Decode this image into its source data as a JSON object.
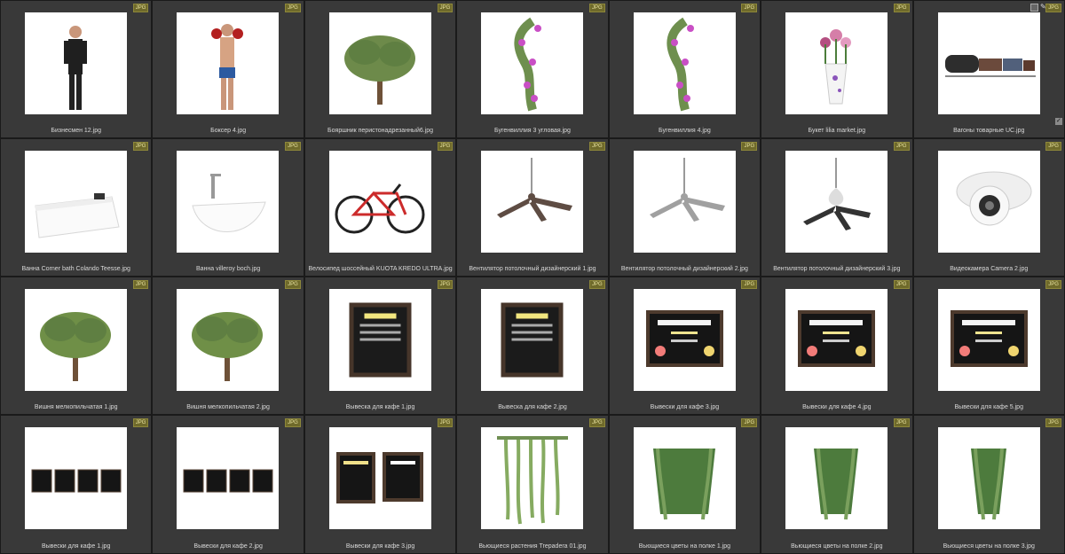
{
  "badge": "JPG",
  "items": [
    {
      "caption": "Бизнесмен 12.jpg",
      "icon": "businessman-model-icon"
    },
    {
      "caption": "Боксер 4.jpg",
      "icon": "boxer-model-icon"
    },
    {
      "caption": "Бояршник перистонадрезанный6.jpg",
      "icon": "tree-icon"
    },
    {
      "caption": "Бугенвиллия 3 угловая.jpg",
      "icon": "bougainvillea-icon"
    },
    {
      "caption": "Бугенвиллия 4.jpg",
      "icon": "bougainvillea-icon"
    },
    {
      "caption": "Букет lilia market.jpg",
      "icon": "bouquet-vase-icon"
    },
    {
      "caption": "Вагоны товарные UC.jpg",
      "icon": "freight-wagons-icon"
    },
    {
      "caption": "Ванна Corner bath Colando Teesse.jpg",
      "icon": "bathtub-corner-icon"
    },
    {
      "caption": "Ванна villeroy boch.jpg",
      "icon": "bathtub-freestanding-icon"
    },
    {
      "caption": "Велосипед шоссейный KUOTA KREDO ULTRA.jpg",
      "icon": "road-bicycle-icon"
    },
    {
      "caption": "Вентилятор потолочный дизайнерский 1.jpg",
      "icon": "ceiling-fan-icon"
    },
    {
      "caption": "Вентилятор потолочный дизайнерский 2.jpg",
      "icon": "ceiling-fan-icon"
    },
    {
      "caption": "Вентилятор потолочный дизайнерский 3.jpg",
      "icon": "ceiling-fan-lamp-icon"
    },
    {
      "caption": "Видеокамера Camera 2.jpg",
      "icon": "security-camera-icon"
    },
    {
      "caption": "Вишня мелкопильчатая 1.jpg",
      "icon": "cherry-tree-icon"
    },
    {
      "caption": "Вишня мелкопильчатая 2.jpg",
      "icon": "cherry-tree-icon"
    },
    {
      "caption": "Вывеска для кафе 1.jpg",
      "icon": "chalkboard-menu-icon"
    },
    {
      "caption": "Вывеска для кафе 2.jpg",
      "icon": "chalkboard-menu-icon"
    },
    {
      "caption": "Вывески для кафе 3.jpg",
      "icon": "cocktail-sign-icon"
    },
    {
      "caption": "Вывески для кафе 4.jpg",
      "icon": "cocktail-sign-icon"
    },
    {
      "caption": "Вывески для кафе 5.jpg",
      "icon": "cocktail-sign-icon"
    },
    {
      "caption": "Вывески для кафе 1.jpg",
      "icon": "menu-boards-set-icon"
    },
    {
      "caption": "Вывески для кафе 2.jpg",
      "icon": "menu-boards-set-icon"
    },
    {
      "caption": "Вывески для кафе 3.jpg",
      "icon": "bar-menu-boards-icon"
    },
    {
      "caption": "Вьющиеся растения Trepadera 01.jpg",
      "icon": "hanging-plant-icon"
    },
    {
      "caption": "Вьющиеся цветы на полке 1.jpg",
      "icon": "hanging-grass-icon"
    },
    {
      "caption": "Вьющиеся цветы на полке 2.jpg",
      "icon": "hanging-grass-icon"
    },
    {
      "caption": "Вьющиеся цветы на полке 3.jpg",
      "icon": "hanging-grass-icon"
    }
  ]
}
